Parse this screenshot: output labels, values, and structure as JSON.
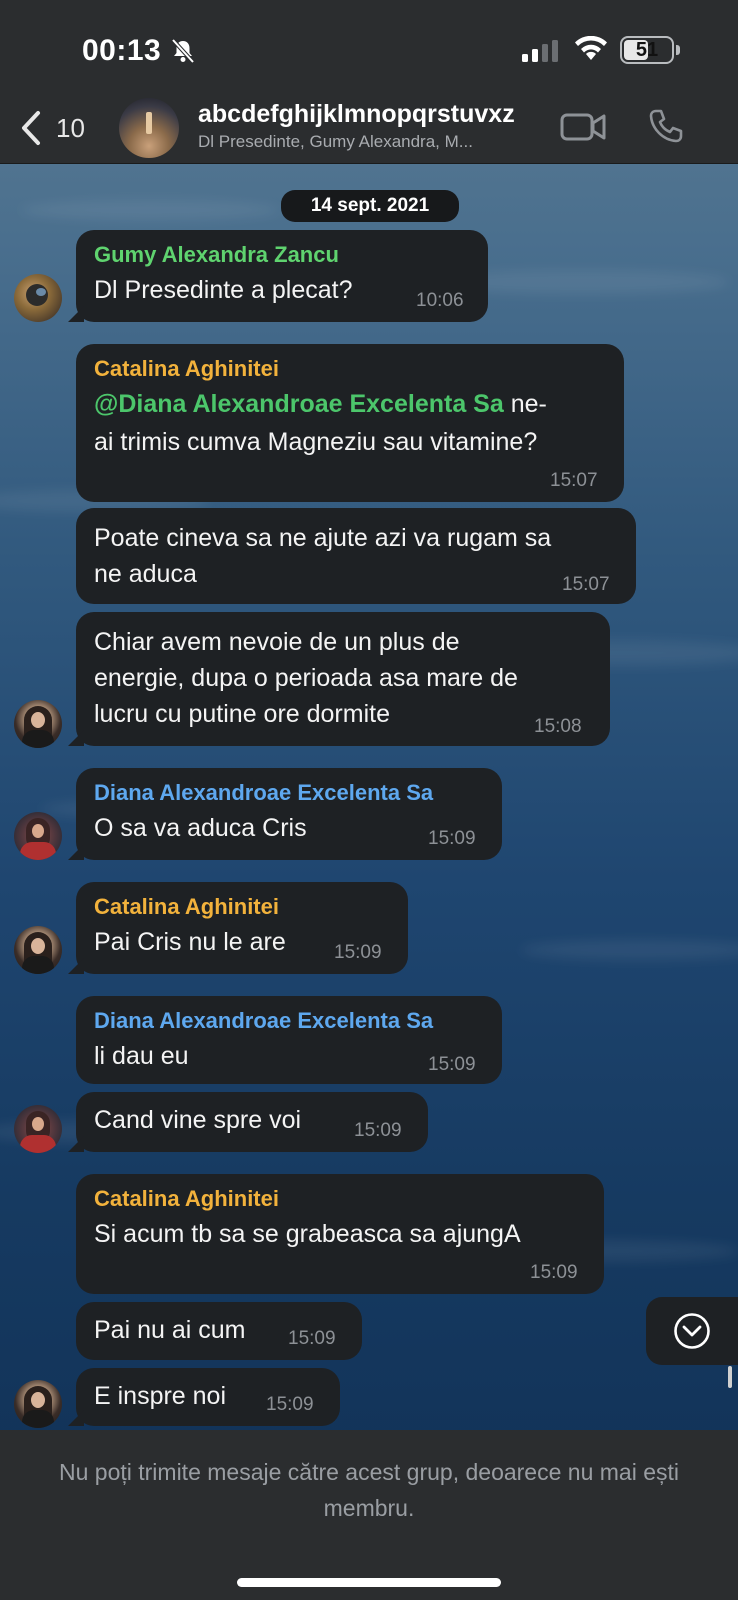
{
  "status_bar": {
    "time": "00:13",
    "battery": "51"
  },
  "header": {
    "back_count": "10",
    "title": "abcdefghijklmnopqrstuvxz",
    "members": "Dl Presedinte, Gumy Alexandra, M..."
  },
  "chat": {
    "date": "14 sept. 2021",
    "messages": [
      {
        "sender": "Gumy Alexandra Zancu",
        "lines": [
          "Dl Presedinte a plecat?"
        ],
        "time": "10:06"
      },
      {
        "sender": "Catalina Aghinitei",
        "mention": "@Diana Alexandroae Excelenta Sa",
        "line1_rest": " ne-",
        "lines": [
          "ai trimis cumva Magneziu sau vitamine?"
        ],
        "time": "15:07"
      },
      {
        "lines": [
          "Poate cineva sa ne ajute azi va rugam sa",
          "ne aduca"
        ],
        "time": "15:07"
      },
      {
        "lines": [
          "Chiar avem nevoie de un plus de",
          "energie, dupa o perioada asa mare de",
          "lucru cu putine ore dormite"
        ],
        "time": "15:08"
      },
      {
        "sender": "Diana Alexandroae Excelenta Sa",
        "lines": [
          "O sa va aduca Cris"
        ],
        "time": "15:09"
      },
      {
        "sender": "Catalina Aghinitei",
        "lines": [
          "Pai Cris nu le are"
        ],
        "time": "15:09"
      },
      {
        "sender": "Diana Alexandroae Excelenta Sa",
        "lines": [
          "li dau eu"
        ],
        "time": "15:09"
      },
      {
        "lines": [
          "Cand vine spre voi"
        ],
        "time": "15:09"
      },
      {
        "sender": "Catalina Aghinitei",
        "lines": [
          "Si acum tb sa se grabeasca sa ajungA"
        ],
        "time": "15:09"
      },
      {
        "lines": [
          "Pai nu ai cum"
        ],
        "time": "15:09"
      },
      {
        "lines": [
          "E inspre noi"
        ],
        "time": "15:09"
      }
    ]
  },
  "footer": {
    "notice": "Nu poți trimite mesaje către acest grup, deoarece nu mai ești membru."
  },
  "colors": {
    "sender_gumy": "#5fd36f",
    "sender_catalina": "#f2b23c",
    "sender_diana": "#5ea8ef",
    "mention": "#4cc66b",
    "bubble": "#1e2124",
    "bar": "#2b2d2f"
  },
  "icons": [
    "chevron-left-icon",
    "video-camera-icon",
    "phone-icon",
    "bell-off-icon",
    "signal-icon",
    "wifi-icon",
    "battery-icon",
    "chevron-down-icon"
  ]
}
